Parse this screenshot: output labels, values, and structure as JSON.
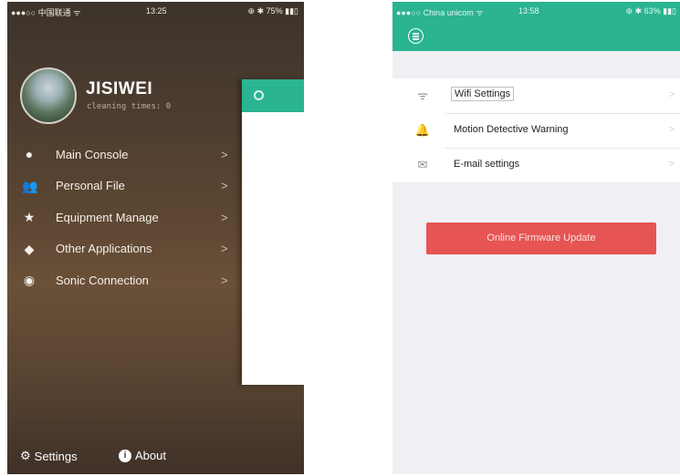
{
  "left_screen": {
    "status_bar": {
      "carrier": "●●●○○ 中国联通 ᯤ",
      "time": "13:25",
      "battery": "⊕ ✱ 75% ▮▮▯"
    },
    "profile": {
      "name": "JISIWEI",
      "subtitle": "cleaning times: 0"
    },
    "menu": [
      {
        "label": "Main Console",
        "icon": "console-icon",
        "glyph": "●"
      },
      {
        "label": "Personal File",
        "icon": "users-icon",
        "glyph": "👥"
      },
      {
        "label": "Equipment Manage",
        "icon": "star-icon",
        "glyph": "★"
      },
      {
        "label": "Other Applications",
        "icon": "cube-icon",
        "glyph": "◆"
      },
      {
        "label": "Sonic Connection",
        "icon": "sonic-icon",
        "glyph": "◉"
      }
    ],
    "menu_chevron": ">",
    "bottom": {
      "settings_label": "Settings",
      "settings_icon": "⚙",
      "about_label": "About",
      "about_icon": "i"
    }
  },
  "right_screen": {
    "status_bar": {
      "carrier": "●●●○○ China unicom ᯤ",
      "time": "13:58",
      "battery": "⊕ ✱ 63% ▮▮▯"
    },
    "settings": [
      {
        "label": "Wifi Settings",
        "icon": "wifi-icon",
        "glyph": "ᯤ"
      },
      {
        "label": "Motion Detective Warning",
        "icon": "bell-icon",
        "glyph": "🔔"
      },
      {
        "label": "E-mail settings",
        "icon": "mail-icon",
        "glyph": "✉"
      }
    ],
    "row_chevron": ">",
    "firmware_button": "Online Firmware Update"
  },
  "colors": {
    "accent": "#2ab48f",
    "danger": "#e65454",
    "drawer_bg": "#5c4632"
  }
}
